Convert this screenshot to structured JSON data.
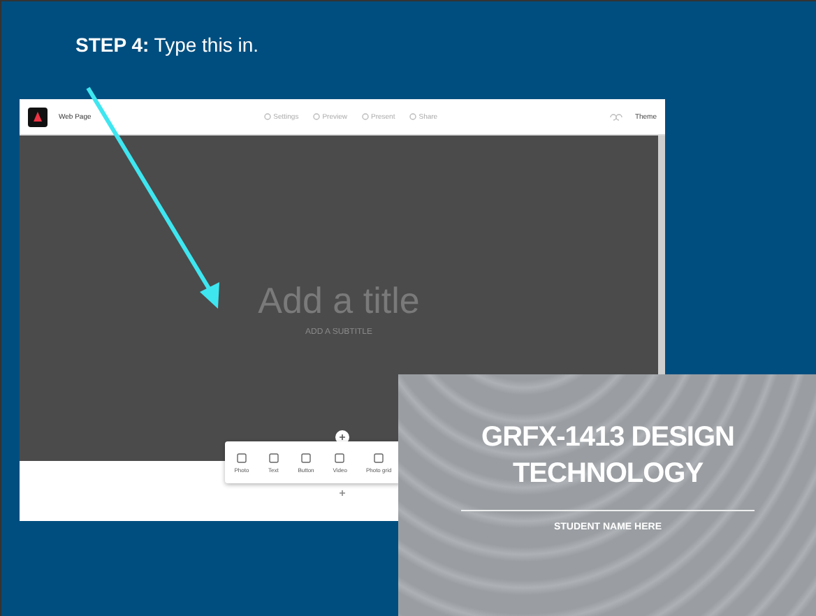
{
  "step": {
    "text": "**STEP 4:** Type this in."
  },
  "editor": {
    "app_title": "Web Page",
    "menu": [
      {
        "label": "Settings"
      },
      {
        "label": "Preview"
      },
      {
        "label": "Present"
      },
      {
        "label": "Share"
      }
    ],
    "theme_button": "Theme",
    "title_placeholder": "Add a title",
    "subtitle_placeholder": "ADD A SUBTITLE",
    "insert_items": [
      {
        "label": "Photo"
      },
      {
        "label": "Text"
      },
      {
        "label": "Button"
      },
      {
        "label": "Video"
      },
      {
        "label": "Photo grid"
      }
    ]
  },
  "title_card": {
    "title": "GRFX-1413 DESIGN TECHNOLOGY",
    "subtitle": "STUDENT NAME HERE"
  }
}
